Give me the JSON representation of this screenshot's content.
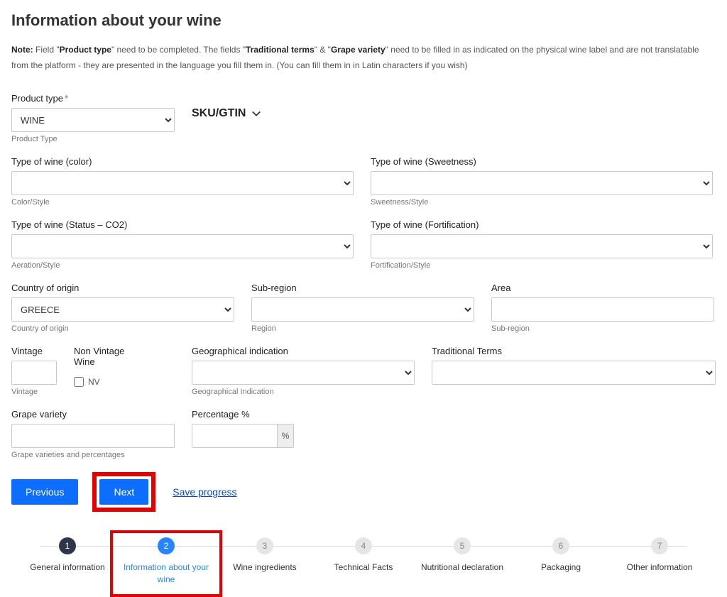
{
  "title": "Information about your wine",
  "note": {
    "prefix": "Note:",
    "t1": " Field \"",
    "b1": "Product type",
    "t2": "\" need to be completed. The fields \"",
    "b2": "Traditional terms",
    "t3": "\" & \"",
    "b3": "Grape variety",
    "t4": "\" need to be filled in as indicated on the physical wine label and are not translatable from the platform - they are presented in the language you fill them in. (You can fill them in in Latin characters if you wish)"
  },
  "fields": {
    "product_type": {
      "label": "Product type",
      "value": "WINE",
      "help": "Product Type"
    },
    "sku_label": "SKU/GTIN",
    "color": {
      "label": "Type of wine (color)",
      "help": "Color/Style"
    },
    "sweetness": {
      "label": "Type of wine (Sweetness)",
      "help": "Sweetness/Style"
    },
    "status": {
      "label": "Type of wine (Status – CO2)",
      "help": "Aeration/Style"
    },
    "fortification": {
      "label": "Type of wine (Fortification)",
      "help": "Fortification/Style"
    },
    "country": {
      "label": "Country of origin",
      "value": "GREECE",
      "help": "Country of origin"
    },
    "subregion": {
      "label": "Sub-region",
      "help": "Region"
    },
    "area": {
      "label": "Area",
      "help": "Sub-region"
    },
    "vintage": {
      "label": "Vintage",
      "help": "Vintage"
    },
    "nv": {
      "label": "Non Vintage Wine",
      "check": "NV"
    },
    "gi": {
      "label": "Geographical indication",
      "help": "Geographical Indication"
    },
    "trad": {
      "label": "Traditional Terms"
    },
    "grape": {
      "label": "Grape variety",
      "help": "Grape varieties and percentages"
    },
    "pct": {
      "label": "Percentage %",
      "addon": "%"
    }
  },
  "actions": {
    "prev": "Previous",
    "next": "Next",
    "save": "Save progress"
  },
  "steps": [
    {
      "n": "1",
      "label": "General information"
    },
    {
      "n": "2",
      "label": "Information about your wine"
    },
    {
      "n": "3",
      "label": "Wine ingredients"
    },
    {
      "n": "4",
      "label": "Technical Facts"
    },
    {
      "n": "5",
      "label": "Nutritional declaration"
    },
    {
      "n": "6",
      "label": "Packaging"
    },
    {
      "n": "7",
      "label": "Other information"
    }
  ]
}
